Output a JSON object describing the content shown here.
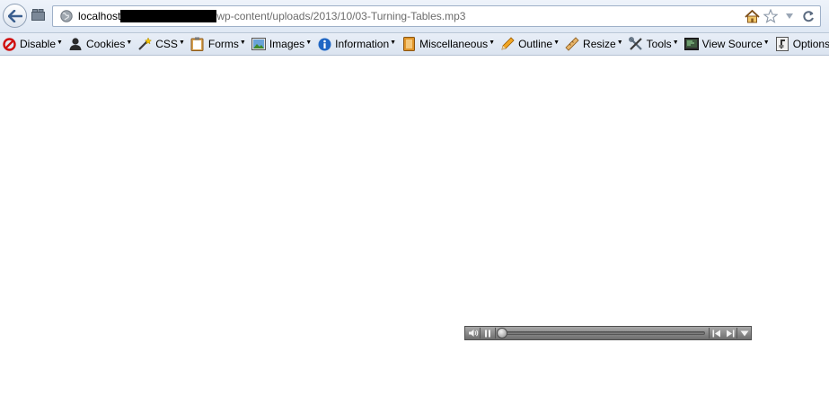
{
  "navbar": {
    "url": {
      "host": "localhost",
      "path": "wp-content/uploads/2013/10/03-Turning-Tables.mp3"
    },
    "icons": {
      "back": "back-arrow-icon",
      "tabs": "tab-groups-icon",
      "site": "globe-icon",
      "home": "home-icon",
      "bookmark": "star-icon",
      "history": "dropdown-arrow-icon",
      "reload": "reload-icon"
    }
  },
  "devbar": {
    "items": [
      {
        "label": "Disable",
        "icon": "disable-icon"
      },
      {
        "label": "Cookies",
        "icon": "cookies-icon"
      },
      {
        "label": "CSS",
        "icon": "css-wand-icon"
      },
      {
        "label": "Forms",
        "icon": "forms-clipboard-icon"
      },
      {
        "label": "Images",
        "icon": "images-picture-icon"
      },
      {
        "label": "Information",
        "icon": "information-icon"
      },
      {
        "label": "Miscellaneous",
        "icon": "miscellaneous-icon"
      },
      {
        "label": "Outline",
        "icon": "outline-pencil-icon"
      },
      {
        "label": "Resize",
        "icon": "resize-ruler-icon"
      },
      {
        "label": "Tools",
        "icon": "tools-icon"
      },
      {
        "label": "View Source",
        "icon": "view-source-icon"
      },
      {
        "label": "Options",
        "icon": "options-icon"
      }
    ]
  },
  "player": {
    "icons": [
      "volume-icon",
      "pause-icon",
      "seek-thumb",
      "rewind-icon",
      "fast-forward-icon",
      "menu-arrow-icon"
    ],
    "progress": 0
  }
}
